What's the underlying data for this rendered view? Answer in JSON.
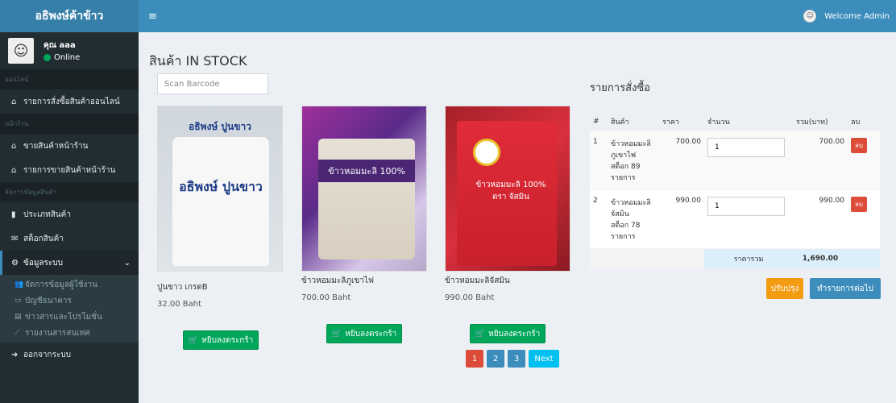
{
  "app": {
    "brand": "อธิพงษ์ค้าข้าว",
    "welcome": "Welcome Admin"
  },
  "user": {
    "name": "คุณ aaa",
    "status": "Online"
  },
  "sidebar": {
    "headers": [
      "ออนไลน์",
      "หน้าร้าน",
      "จัดการข้อมูลสินค้า"
    ],
    "items": [
      "รายการสั่งซื้อสินค้าออนไลน์",
      "ขายสินค้าหน้าร้าน",
      "รายการขายสินค้าหน้าร้าน",
      "ประเภทสินค้า",
      "สต็อกสินค้า",
      "ข้อมูลระบบ"
    ],
    "submenu": [
      "จัดการข้อมูลผู้ใช้งาน",
      "บัญชีธนาคาร",
      "ข่าวสารและโปรโมชั่น",
      "รายงานสารสนเทศ"
    ],
    "logout": "ออกจากระบบ"
  },
  "main": {
    "title": "สินค้า IN STOCK",
    "barcode_placeholder": "Scan Barcode",
    "products": [
      {
        "name": "ปูนขาว เกรดB",
        "price": "32.00 Baht",
        "img_text1": "อธิพงษ์ ปูนขาว",
        "img_text2": "อธิพงษ์ ปูนขาว"
      },
      {
        "name": "ข้าวหอมมะลิภูเขาไฟ",
        "price": "700.00 Baht",
        "img_text1": "ข้าวหอมมะลิ 100%"
      },
      {
        "name": "ข้าวหอมมะลิจัสมิน",
        "price": "990.00 Baht",
        "img_text1": "ข้าวหอมมะลิ 100% ตรา จัสมิน"
      }
    ],
    "add_to_cart": "หยิบลงตระกร้า",
    "pagination": [
      "1",
      "2",
      "3",
      "Next"
    ]
  },
  "order": {
    "title": "รายการสั่งซื้อ",
    "headers": [
      "#",
      "สินค้า",
      "ราคา",
      "จำนวน",
      "รวม(บาท)",
      "ลบ"
    ],
    "rows": [
      {
        "no": "1",
        "product": "ข้าวหอมมะลิภูเขาไฟ",
        "stock": "สต็อก 89 รายการ",
        "price": "700.00",
        "qty": "1",
        "total": "700.00"
      },
      {
        "no": "2",
        "product": "ข้าวหอมมะลิจัสมิน",
        "stock": "สต็อก 78 รายการ",
        "price": "990.00",
        "qty": "1",
        "total": "990.00"
      }
    ],
    "delete_label": "ลบ",
    "grand_total_label": "ราคารวม",
    "grand_total": "1,690.00",
    "refresh_button": "ปรับปรุง",
    "continue_button": "ทำรายการต่อไป"
  },
  "colors": {
    "primary": "#3c8dbc",
    "success": "#00a65a",
    "danger": "#dd4b39",
    "warning": "#f39c12",
    "sidebar": "#222d32"
  }
}
